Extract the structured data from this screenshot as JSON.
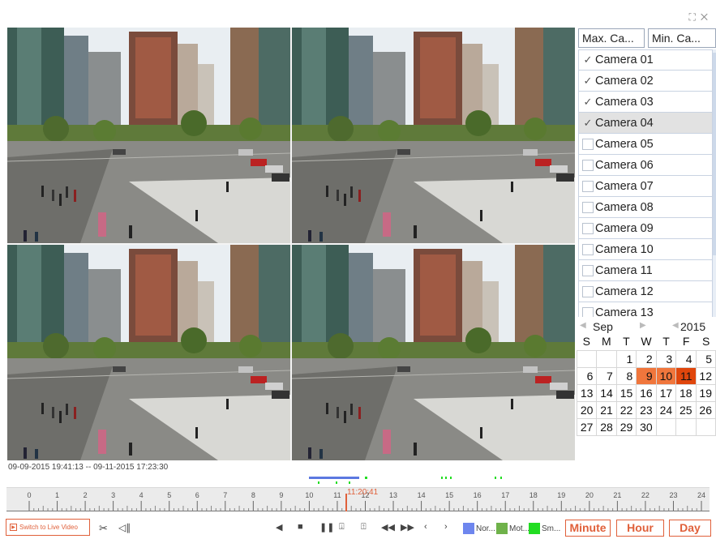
{
  "window": {
    "fullscreen_icon": "fullscreen-icon",
    "close_icon": "close-icon"
  },
  "camera_panel": {
    "max_label": "Max. Ca...",
    "min_label": "Min. Ca...",
    "cameras": [
      {
        "name": "Camera 01",
        "checked": true
      },
      {
        "name": "Camera 02",
        "checked": true
      },
      {
        "name": "Camera 03",
        "checked": true
      },
      {
        "name": "Camera 04",
        "checked": true,
        "selected": true
      },
      {
        "name": "Camera 05",
        "checked": false
      },
      {
        "name": "Camera 06",
        "checked": false
      },
      {
        "name": "Camera 07",
        "checked": false
      },
      {
        "name": "Camera 08",
        "checked": false
      },
      {
        "name": "Camera 09",
        "checked": false
      },
      {
        "name": "Camera 10",
        "checked": false
      },
      {
        "name": "Camera 11",
        "checked": false
      },
      {
        "name": "Camera 12",
        "checked": false
      },
      {
        "name": "Camera 13",
        "checked": false
      }
    ]
  },
  "calendar": {
    "month": "Sep",
    "year": "2015",
    "weekdays": [
      "S",
      "M",
      "T",
      "W",
      "T",
      "F",
      "S"
    ],
    "weeks": [
      [
        "",
        "",
        "1",
        "2",
        "3",
        "4",
        "5"
      ],
      [
        "6",
        "7",
        "8",
        "9",
        "10",
        "11",
        "12"
      ],
      [
        "13",
        "14",
        "15",
        "16",
        "17",
        "18",
        "19"
      ],
      [
        "20",
        "21",
        "22",
        "23",
        "24",
        "25",
        "26"
      ],
      [
        "27",
        "28",
        "29",
        "30",
        "",
        "",
        ""
      ]
    ],
    "recorded_days": [
      "9",
      "10",
      "11"
    ],
    "current_day": "11",
    "recorded_color": "#f0763c",
    "current_color": "#e0460c"
  },
  "playback": {
    "range": "09-09-2015 19:41:13 -- 09-11-2015 17:23:30",
    "current_time": "11:20:41",
    "hour_labels": [
      "0",
      "1",
      "2",
      "3",
      "4",
      "5",
      "6",
      "7",
      "8",
      "9",
      "10",
      "11",
      "12",
      "13",
      "14",
      "15",
      "16",
      "17",
      "18",
      "19",
      "20",
      "21",
      "22",
      "23",
      "24"
    ],
    "current_hour_value": 11.34
  },
  "toolbar": {
    "live_label": "Switch to Live Video",
    "legend": [
      {
        "label": "Nor...",
        "color": "#6e86ee"
      },
      {
        "label": "Mot...",
        "color": "#6fb24a"
      },
      {
        "label": "Sm...",
        "color": "#22dd22"
      }
    ],
    "zoom": [
      "Minute",
      "Hour",
      "Day"
    ],
    "accent": "#e0603a"
  }
}
